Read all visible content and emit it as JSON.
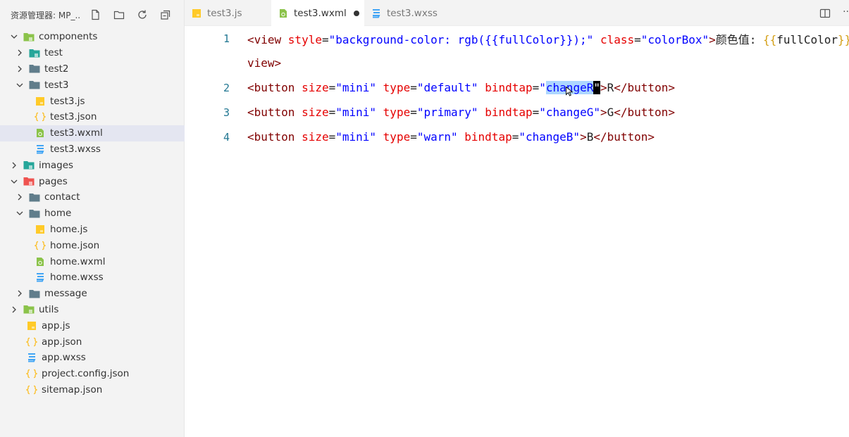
{
  "sidebar": {
    "title": "资源管理器: MP_...",
    "actions": [
      "new-file-icon",
      "new-folder-icon",
      "refresh-icon",
      "collapse-all-icon"
    ],
    "tree": [
      {
        "label": "components",
        "depth": 0,
        "kind": "folder-special",
        "expanded": true,
        "icon_color": "#8bc34a"
      },
      {
        "label": "test",
        "depth": 1,
        "kind": "folder-special",
        "expanded": false,
        "icon_color": "#26a69a"
      },
      {
        "label": "test2",
        "depth": 1,
        "kind": "folder",
        "expanded": false,
        "icon_color": "#607d8b"
      },
      {
        "label": "test3",
        "depth": 1,
        "kind": "folder",
        "expanded": true,
        "icon_color": "#607d8b"
      },
      {
        "label": "test3.js",
        "depth": 2,
        "kind": "js",
        "icon_color": "#ffca28"
      },
      {
        "label": "test3.json",
        "depth": 2,
        "kind": "json",
        "icon_color": "#fbc02d"
      },
      {
        "label": "test3.wxml",
        "depth": 2,
        "kind": "wxml",
        "icon_color": "#8bc34a",
        "selected": true
      },
      {
        "label": "test3.wxss",
        "depth": 2,
        "kind": "wxss",
        "icon_color": "#42a5f5"
      },
      {
        "label": "images",
        "depth": 0,
        "kind": "folder-special",
        "expanded": false,
        "icon_color": "#26a69a"
      },
      {
        "label": "pages",
        "depth": 0,
        "kind": "folder-special",
        "expanded": true,
        "icon_color": "#ef5350"
      },
      {
        "label": "contact",
        "depth": 1,
        "kind": "folder",
        "expanded": false,
        "icon_color": "#607d8b"
      },
      {
        "label": "home",
        "depth": 1,
        "kind": "folder",
        "expanded": true,
        "icon_color": "#607d8b"
      },
      {
        "label": "home.js",
        "depth": 2,
        "kind": "js",
        "icon_color": "#ffca28"
      },
      {
        "label": "home.json",
        "depth": 2,
        "kind": "json",
        "icon_color": "#fbc02d"
      },
      {
        "label": "home.wxml",
        "depth": 2,
        "kind": "wxml",
        "icon_color": "#8bc34a"
      },
      {
        "label": "home.wxss",
        "depth": 2,
        "kind": "wxss",
        "icon_color": "#42a5f5"
      },
      {
        "label": "message",
        "depth": 1,
        "kind": "folder",
        "expanded": false,
        "icon_color": "#607d8b"
      },
      {
        "label": "utils",
        "depth": 0,
        "kind": "folder-special",
        "expanded": false,
        "icon_color": "#8bc34a"
      },
      {
        "label": "app.js",
        "depth": 0,
        "kind": "js",
        "icon_color": "#ffca28"
      },
      {
        "label": "app.json",
        "depth": 0,
        "kind": "json",
        "icon_color": "#fbc02d"
      },
      {
        "label": "app.wxss",
        "depth": 0,
        "kind": "wxss",
        "icon_color": "#42a5f5"
      },
      {
        "label": "project.config.json",
        "depth": 0,
        "kind": "json",
        "icon_color": "#fbc02d"
      },
      {
        "label": "sitemap.json",
        "depth": 0,
        "kind": "json",
        "icon_color": "#fbc02d"
      }
    ]
  },
  "tabs": [
    {
      "label": "test3.js",
      "kind": "js",
      "active": false
    },
    {
      "label": "test3.wxml",
      "kind": "wxml",
      "active": true,
      "dirty": true
    },
    {
      "label": "test3.wxss",
      "kind": "wxss",
      "active": false
    }
  ],
  "tabbar": {
    "more": "··"
  },
  "editor": {
    "lines": [
      {
        "num": "1",
        "tokens": [
          {
            "t": "<view ",
            "c": "tag"
          },
          {
            "t": "style",
            "c": "attr"
          },
          {
            "t": "=",
            "c": "txt"
          },
          {
            "t": "\"background-color: rgb(",
            "c": "str"
          },
          {
            "t": "{{",
            "c": "str"
          },
          {
            "t": "fullColor",
            "c": "str"
          },
          {
            "t": "}}",
            "c": "str"
          },
          {
            "t": ");\"",
            "c": "str"
          },
          {
            "t": " ",
            "c": "txt"
          },
          {
            "t": "class",
            "c": "attr"
          },
          {
            "t": "=",
            "c": "txt"
          },
          {
            "t": "\"colorBox\"",
            "c": "str"
          },
          {
            "t": ">",
            "c": "tag"
          },
          {
            "t": "颜色值: ",
            "c": "txt"
          },
          {
            "t": "{{",
            "c": "brace"
          },
          {
            "t": "fullColor",
            "c": "txt"
          },
          {
            "t": "}}",
            "c": "brace"
          },
          {
            "t": "</",
            "c": "tag"
          }
        ]
      },
      {
        "num": "",
        "tokens": [
          {
            "t": "view",
            "c": "tag"
          },
          {
            "t": ">",
            "c": "tag"
          }
        ]
      },
      {
        "num": "2",
        "tokens": [
          {
            "t": "<button ",
            "c": "tag"
          },
          {
            "t": "size",
            "c": "attr"
          },
          {
            "t": "=",
            "c": "txt"
          },
          {
            "t": "\"mini\"",
            "c": "str"
          },
          {
            "t": " ",
            "c": "txt"
          },
          {
            "t": "type",
            "c": "attr"
          },
          {
            "t": "=",
            "c": "txt"
          },
          {
            "t": "\"default\"",
            "c": "str"
          },
          {
            "t": " ",
            "c": "txt"
          },
          {
            "t": "bindtap",
            "c": "attr"
          },
          {
            "t": "=",
            "c": "txt"
          },
          {
            "t": "\"",
            "c": "str"
          },
          {
            "t": "changeR",
            "c": "str sel"
          },
          {
            "t": "\"",
            "c": "cursor-block"
          },
          {
            "t": ">",
            "c": "tag"
          },
          {
            "t": "R",
            "c": "txt"
          },
          {
            "t": "</button>",
            "c": "tag"
          }
        ]
      },
      {
        "num": "3",
        "tokens": [
          {
            "t": "<button ",
            "c": "tag"
          },
          {
            "t": "size",
            "c": "attr"
          },
          {
            "t": "=",
            "c": "txt"
          },
          {
            "t": "\"mini\"",
            "c": "str"
          },
          {
            "t": " ",
            "c": "txt"
          },
          {
            "t": "type",
            "c": "attr"
          },
          {
            "t": "=",
            "c": "txt"
          },
          {
            "t": "\"primary\"",
            "c": "str"
          },
          {
            "t": " ",
            "c": "txt"
          },
          {
            "t": "bindtap",
            "c": "attr"
          },
          {
            "t": "=",
            "c": "txt"
          },
          {
            "t": "\"changeG\"",
            "c": "str"
          },
          {
            "t": ">",
            "c": "tag"
          },
          {
            "t": "G",
            "c": "txt"
          },
          {
            "t": "</button>",
            "c": "tag"
          }
        ]
      },
      {
        "num": "4",
        "tokens": [
          {
            "t": "<button ",
            "c": "tag"
          },
          {
            "t": "size",
            "c": "attr"
          },
          {
            "t": "=",
            "c": "txt"
          },
          {
            "t": "\"mini\"",
            "c": "str"
          },
          {
            "t": " ",
            "c": "txt"
          },
          {
            "t": "type",
            "c": "attr"
          },
          {
            "t": "=",
            "c": "txt"
          },
          {
            "t": "\"warn\"",
            "c": "str"
          },
          {
            "t": " ",
            "c": "txt"
          },
          {
            "t": "bindtap",
            "c": "attr"
          },
          {
            "t": "=",
            "c": "txt"
          },
          {
            "t": "\"changeB\"",
            "c": "str"
          },
          {
            "t": ">",
            "c": "tag"
          },
          {
            "t": "B",
            "c": "txt"
          },
          {
            "t": "</button>",
            "c": "tag"
          }
        ]
      }
    ]
  },
  "colors": {
    "sidebar_bg": "#f3f3f3",
    "selected_row": "#e4e6f1",
    "line_number": "#237893",
    "tag": "#800000",
    "attr": "#e50000",
    "string": "#0000ff",
    "selection": "#add6ff"
  }
}
